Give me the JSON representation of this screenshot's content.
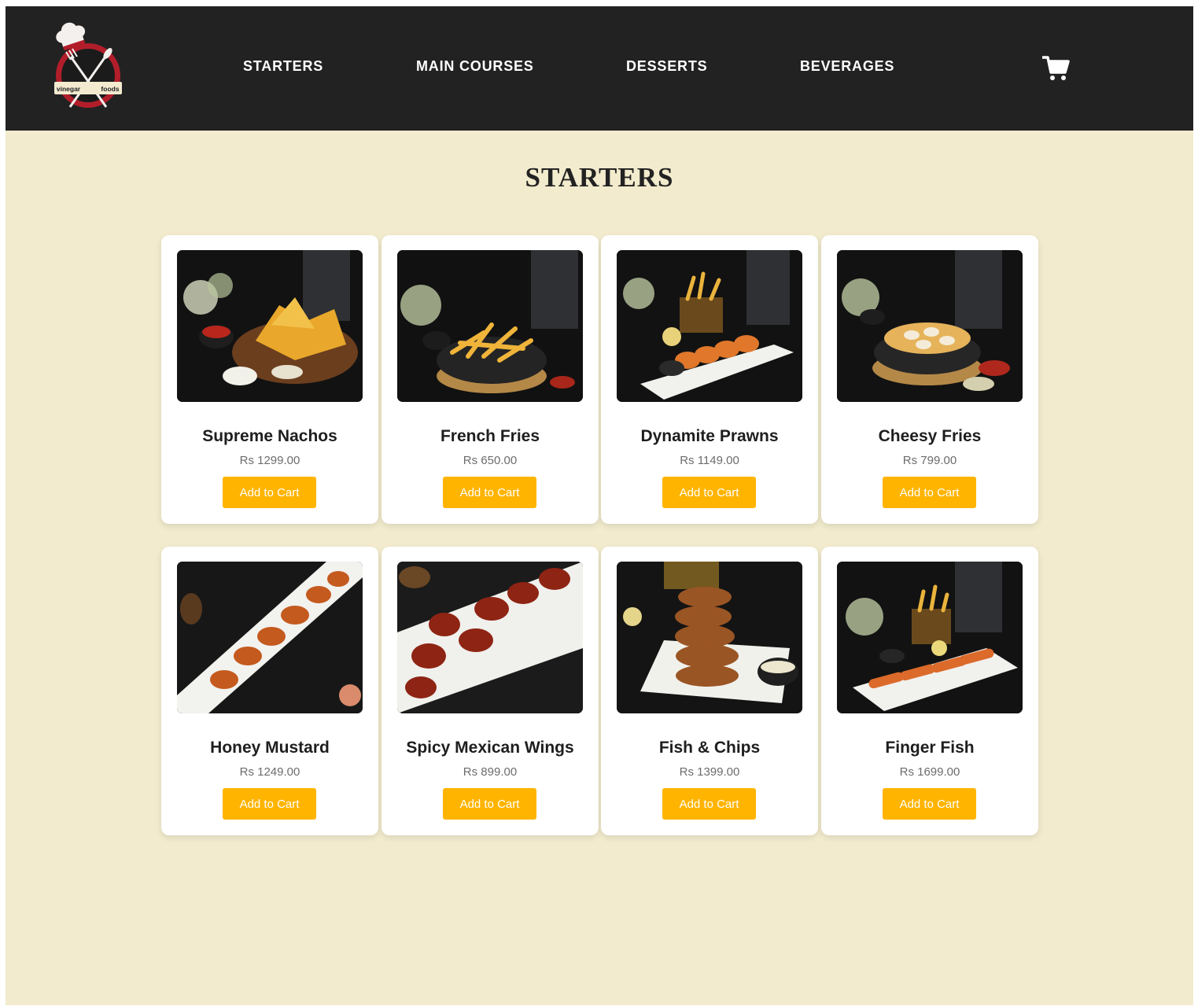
{
  "brand": {
    "logo_text_left": "vinegar",
    "logo_text_right": "foods"
  },
  "nav": {
    "items": [
      {
        "label": "STARTERS"
      },
      {
        "label": "MAIN COURSES"
      },
      {
        "label": "DESSERTS"
      },
      {
        "label": "BEVERAGES"
      }
    ],
    "cart_icon": "shopping-cart-icon"
  },
  "page": {
    "title": "STARTERS"
  },
  "products": [
    {
      "name": "Supreme Nachos",
      "price": "Rs 1299.00",
      "button": "Add to Cart"
    },
    {
      "name": "French Fries",
      "price": "Rs 650.00",
      "button": "Add to Cart"
    },
    {
      "name": "Dynamite Prawns",
      "price": "Rs 1149.00",
      "button": "Add to Cart"
    },
    {
      "name": "Cheesy Fries",
      "price": "Rs 799.00",
      "button": "Add to Cart"
    },
    {
      "name": "Honey Mustard",
      "price": "Rs 1249.00",
      "button": "Add to Cart"
    },
    {
      "name": "Spicy Mexican Wings",
      "price": "Rs 899.00",
      "button": "Add to Cart"
    },
    {
      "name": "Fish & Chips",
      "price": "Rs 1399.00",
      "button": "Add to Cart"
    },
    {
      "name": "Finger Fish",
      "price": "Rs 1699.00",
      "button": "Add to Cart"
    }
  ],
  "colors": {
    "navbar": "#222222",
    "background": "#f2ebcd",
    "accent": "#ffb400",
    "card": "#ffffff"
  }
}
